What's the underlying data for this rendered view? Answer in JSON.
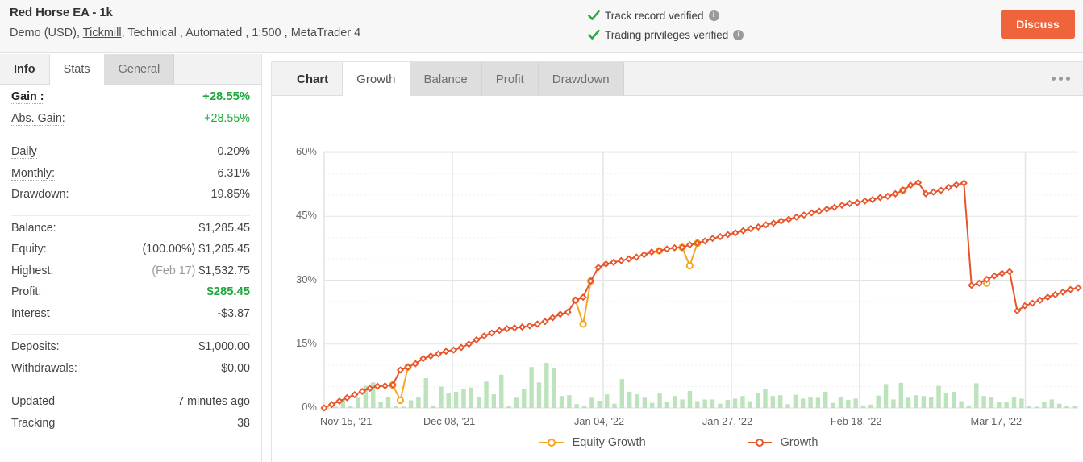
{
  "header": {
    "account_title": "Red Horse EA - 1k",
    "subtitle_prefix": "Demo (USD),",
    "broker_link": "Tickmill",
    "subtitle_suffix": ", Technical , Automated , 1:500 , MetaTrader 4",
    "verified": [
      {
        "label": "Track record verified",
        "info": "i"
      },
      {
        "label": "Trading privileges verified",
        "info": "i"
      }
    ],
    "discuss_label": "Discuss",
    "discuss_color": "#f0643c"
  },
  "sidebar": {
    "tabs": [
      {
        "label": "Info",
        "state": "plain"
      },
      {
        "label": "Stats",
        "state": "active"
      },
      {
        "label": "General",
        "state": "inactive"
      }
    ],
    "groups": [
      {
        "rows": [
          {
            "label": "Gain :",
            "value": "+28.55%",
            "label_bold": true,
            "dotted": true,
            "value_color": "green",
            "value_bold": true
          },
          {
            "label": "Abs. Gain:",
            "value": "+28.55%",
            "dotted": true,
            "value_color": "green"
          }
        ]
      },
      {
        "rows": [
          {
            "label": "Daily",
            "value": "0.20%",
            "dotted": true
          },
          {
            "label": "Monthly:",
            "value": "6.31%",
            "dotted": true
          },
          {
            "label": "Drawdown:",
            "value": "19.85%"
          }
        ]
      },
      {
        "rows": [
          {
            "label": "Balance:",
            "value": "$1,285.45"
          },
          {
            "label": "Equity:",
            "prefix": "(100.00%)",
            "value": "$1,285.45"
          },
          {
            "label": "Highest:",
            "prefix": "(Feb 17)",
            "prefix_muted": true,
            "value": "$1,532.75"
          },
          {
            "label": "Profit:",
            "value": "$285.45",
            "value_color": "green",
            "value_bold": true
          },
          {
            "label": "Interest",
            "value": "-$3.87"
          }
        ]
      },
      {
        "rows": [
          {
            "label": "Deposits:",
            "value": "$1,000.00"
          },
          {
            "label": "Withdrawals:",
            "value": "$0.00"
          }
        ]
      },
      {
        "rows": [
          {
            "label": "Updated",
            "value": "7 minutes ago"
          },
          {
            "label": "Tracking",
            "value": "38"
          }
        ]
      }
    ]
  },
  "chart_panel": {
    "tabs": [
      {
        "label": "Chart",
        "state": "plain"
      },
      {
        "label": "Growth",
        "state": "active"
      },
      {
        "label": "Balance",
        "state": "inactive"
      },
      {
        "label": "Profit",
        "state": "inactive"
      },
      {
        "label": "Drawdown",
        "state": "inactive"
      }
    ],
    "menu_icon": "ellipsis-icon"
  },
  "chart_data": {
    "type": "line",
    "title": "Growth",
    "xlabel": "",
    "ylabel": "",
    "ylim": [
      0,
      60
    ],
    "yticks": [
      0,
      15,
      30,
      45,
      60
    ],
    "ytick_labels": [
      "0%",
      "15%",
      "30%",
      "45%",
      "60%"
    ],
    "grid": true,
    "legend_position": "bottom",
    "xtick_labels": [
      "Nov 15, '21",
      "Dec 08, '21",
      "Jan 04, '22",
      "Jan 27, '22",
      "Feb 18, '22",
      "Mar 17, '22"
    ],
    "xtick_positions": [
      0,
      17,
      37,
      54,
      71,
      93
    ],
    "n_points": 100,
    "colors": {
      "growth": "#e8542a",
      "equity_growth": "#f5a623",
      "bars": "#b5e0b5"
    },
    "series": [
      {
        "name": "Growth",
        "color": "#e8542a",
        "values": [
          0.0,
          0.8,
          1.6,
          2.4,
          3.1,
          3.9,
          4.6,
          5.1,
          5.2,
          5.4,
          8.9,
          9.6,
          10.4,
          11.6,
          12.2,
          12.7,
          13.3,
          13.6,
          14.2,
          15.0,
          16.0,
          16.9,
          17.6,
          18.2,
          18.6,
          18.8,
          19.0,
          19.3,
          19.7,
          20.3,
          21.2,
          22.0,
          22.5,
          25.3,
          26.0,
          29.8,
          33.0,
          33.8,
          34.2,
          34.6,
          35.0,
          35.4,
          36.0,
          36.6,
          36.9,
          37.3,
          37.6,
          37.7,
          38.3,
          38.7,
          39.2,
          39.8,
          40.2,
          40.7,
          41.1,
          41.6,
          42.1,
          42.5,
          43.0,
          43.4,
          43.9,
          44.3,
          44.8,
          45.3,
          45.8,
          46.2,
          46.7,
          47.1,
          47.6,
          48.0,
          48.2,
          48.6,
          48.9,
          49.4,
          49.7,
          50.3,
          51.1,
          52.3,
          52.9,
          50.3,
          50.7,
          51.1,
          51.8,
          52.4,
          52.8,
          28.8,
          29.3,
          30.2,
          31.0,
          31.6,
          32.0,
          22.8,
          24.0,
          24.6,
          25.3,
          26.0,
          26.6,
          27.2,
          27.8,
          28.2
        ]
      },
      {
        "name": "Equity Growth",
        "color": "#f5a623",
        "points": [
          {
            "index": 9,
            "value": 5.4
          },
          {
            "index": 10,
            "value": 1.8
          },
          {
            "index": 11,
            "value": 9.6
          },
          {
            "index": 33,
            "value": 25.3
          },
          {
            "index": 34,
            "value": 19.7
          },
          {
            "index": 35,
            "value": 29.8
          },
          {
            "index": 44,
            "value": 36.9
          },
          {
            "index": 47,
            "value": 37.7
          },
          {
            "index": 48,
            "value": 33.4
          },
          {
            "index": 49,
            "value": 38.7
          },
          {
            "index": 76,
            "value": 51.1
          },
          {
            "index": 87,
            "value": 29.3
          }
        ]
      }
    ],
    "bars": {
      "name": "Trading Activity",
      "color": "#b5e0b5",
      "max_height_pct": 11,
      "values": [
        0.0,
        0.3,
        2.0,
        0.4,
        2.4,
        5.2,
        6.0,
        1.5,
        2.6,
        0.5,
        0.3,
        1.8,
        2.6,
        7.0,
        0.6,
        5.0,
        3.4,
        3.8,
        4.4,
        4.8,
        2.5,
        6.2,
        3.2,
        7.8,
        0.5,
        2.4,
        4.4,
        9.6,
        6.0,
        10.6,
        9.4,
        2.8,
        3.0,
        0.9,
        0.5,
        2.4,
        1.7,
        3.2,
        1.0,
        6.8,
        3.8,
        3.2,
        2.4,
        1.2,
        3.4,
        1.5,
        2.8,
        2.0,
        4.0,
        1.6,
        2.0,
        2.0,
        1.0,
        1.9,
        2.2,
        2.8,
        1.6,
        3.6,
        4.4,
        2.8,
        3.0,
        0.9,
        3.1,
        2.2,
        2.6,
        2.4,
        3.8,
        1.2,
        2.6,
        1.9,
        2.2,
        0.6,
        0.8,
        2.9,
        5.6,
        2.0,
        5.9,
        2.4,
        3.0,
        2.8,
        2.6,
        5.2,
        3.4,
        3.8,
        1.6,
        0.6,
        5.8,
        2.8,
        2.6,
        1.4,
        1.5,
        2.6,
        2.2,
        0.4,
        0.3,
        1.4,
        2.0,
        1.0,
        0.5,
        0.4
      ]
    },
    "legend": [
      {
        "label": "Equity Growth",
        "color": "#f5a623"
      },
      {
        "label": "Growth",
        "color": "#e8542a"
      }
    ]
  }
}
